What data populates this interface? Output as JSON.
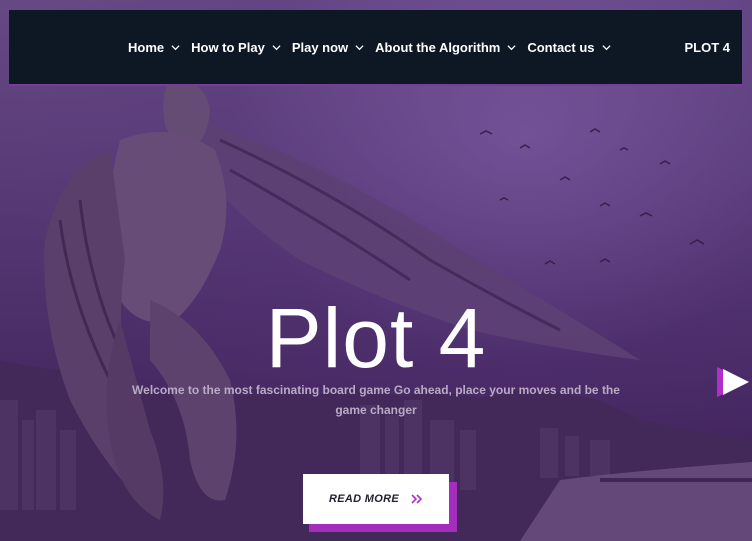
{
  "nav": {
    "items": [
      {
        "label": "Home"
      },
      {
        "label": "How to Play"
      },
      {
        "label": "Play now"
      },
      {
        "label": "About the Algorithm"
      },
      {
        "label": "Contact us"
      }
    ],
    "brand": "PLOT 4"
  },
  "hero": {
    "title": "Plot 4",
    "subtitle": "Welcome to the most fascinating board game Go ahead, place your moves and be the game changer",
    "cta_label": "READ MORE",
    "background_description_icon": "angel-statue-city-image"
  },
  "colors": {
    "nav_bg": "#0e1825",
    "accent": "#a32ebd",
    "text": "#ffffff"
  }
}
